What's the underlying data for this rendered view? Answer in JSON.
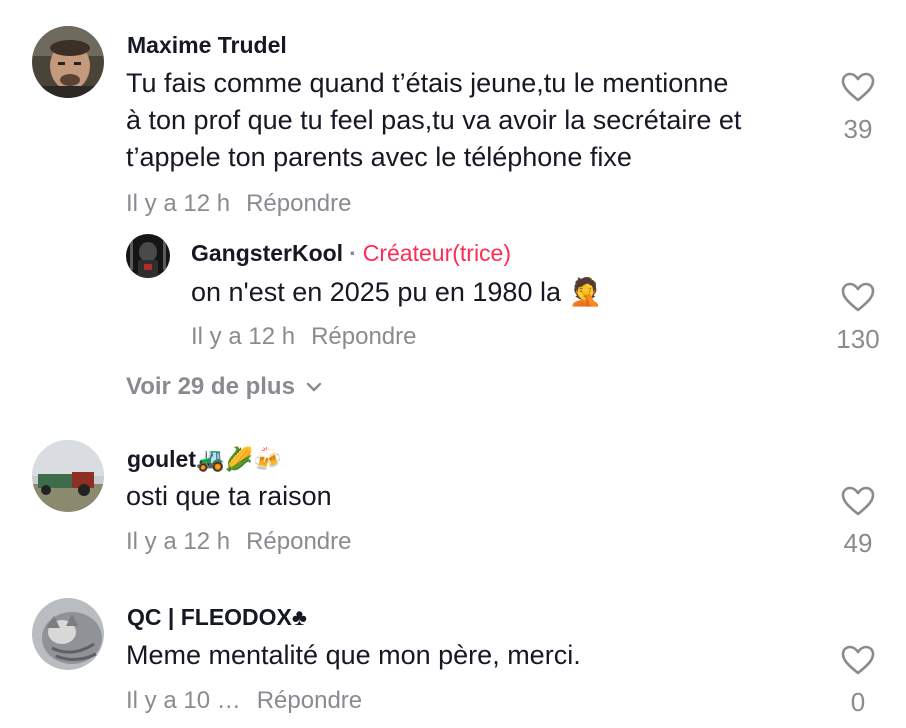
{
  "comments": [
    {
      "username": "Maxime Trudel",
      "text_lines": [
        "Tu fais comme quand t’étais jeune,tu le mentionne",
        "à ton prof que tu feel pas,tu va avoir la secrétaire et",
        "t’appele ton parents avec le téléphone fixe"
      ],
      "time": "Il y a 12 h",
      "reply_label": "Répondre",
      "likes": "39",
      "replies": [
        {
          "username": "GangsterKool",
          "separator": "·",
          "badge": "Créateur(trice)",
          "text": "on n'est en 2025 pu en 1980 la 🤦",
          "time": "Il y a 12 h",
          "reply_label": "Répondre",
          "likes": "130"
        }
      ],
      "view_more": "Voir 29 de plus"
    },
    {
      "username": "goulet🚜🌽🍻",
      "text": "osti que ta raison",
      "time": "Il y a 12 h",
      "reply_label": "Répondre",
      "likes": "49"
    },
    {
      "username": "QC | FLEODOX♣",
      "text": "Meme mentalité que mon père, merci.",
      "time": "Il y a 10 …",
      "reply_label": "Répondre",
      "likes": "0"
    }
  ],
  "colors": {
    "text": "#161823",
    "secondary": "#8a8b91",
    "creator_badge": "#fe2c55"
  },
  "icons": {
    "like": "heart-outline-icon",
    "expand": "chevron-down-icon"
  }
}
